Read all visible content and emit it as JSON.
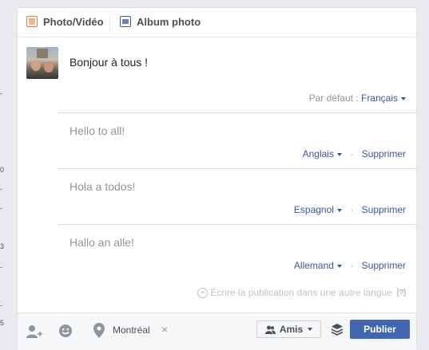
{
  "tabs": [
    {
      "label": "Photo/Vidéo",
      "icon": "photo-video-icon"
    },
    {
      "label": "Album photo",
      "icon": "photo-album-icon"
    }
  ],
  "composer": {
    "text": "Bonjour à tous !",
    "default_label": "Par défaut :",
    "default_language": "Français"
  },
  "translations": [
    {
      "text": "Hello to all!",
      "language": "Anglais",
      "delete_label": "Supprimer"
    },
    {
      "text": "Hola a todos!",
      "language": "Espagnol",
      "delete_label": "Supprimer"
    },
    {
      "text": "Hallo an alle!",
      "language": "Allemand",
      "delete_label": "Supprimer"
    }
  ],
  "separator": "·",
  "write_other": {
    "label": "Écrire la publication dans une autre langue",
    "help": "[?]"
  },
  "footer": {
    "location": "Montréal",
    "remove": "×",
    "audience": "Amis",
    "publish": "Publier"
  },
  "left_edge_marks": [
    "-",
    "0",
    "-",
    "-",
    "3",
    "-",
    "-",
    "5"
  ],
  "colors": {
    "link": "#365899",
    "publish_bg": "#4267b2",
    "muted": "#90949c"
  }
}
